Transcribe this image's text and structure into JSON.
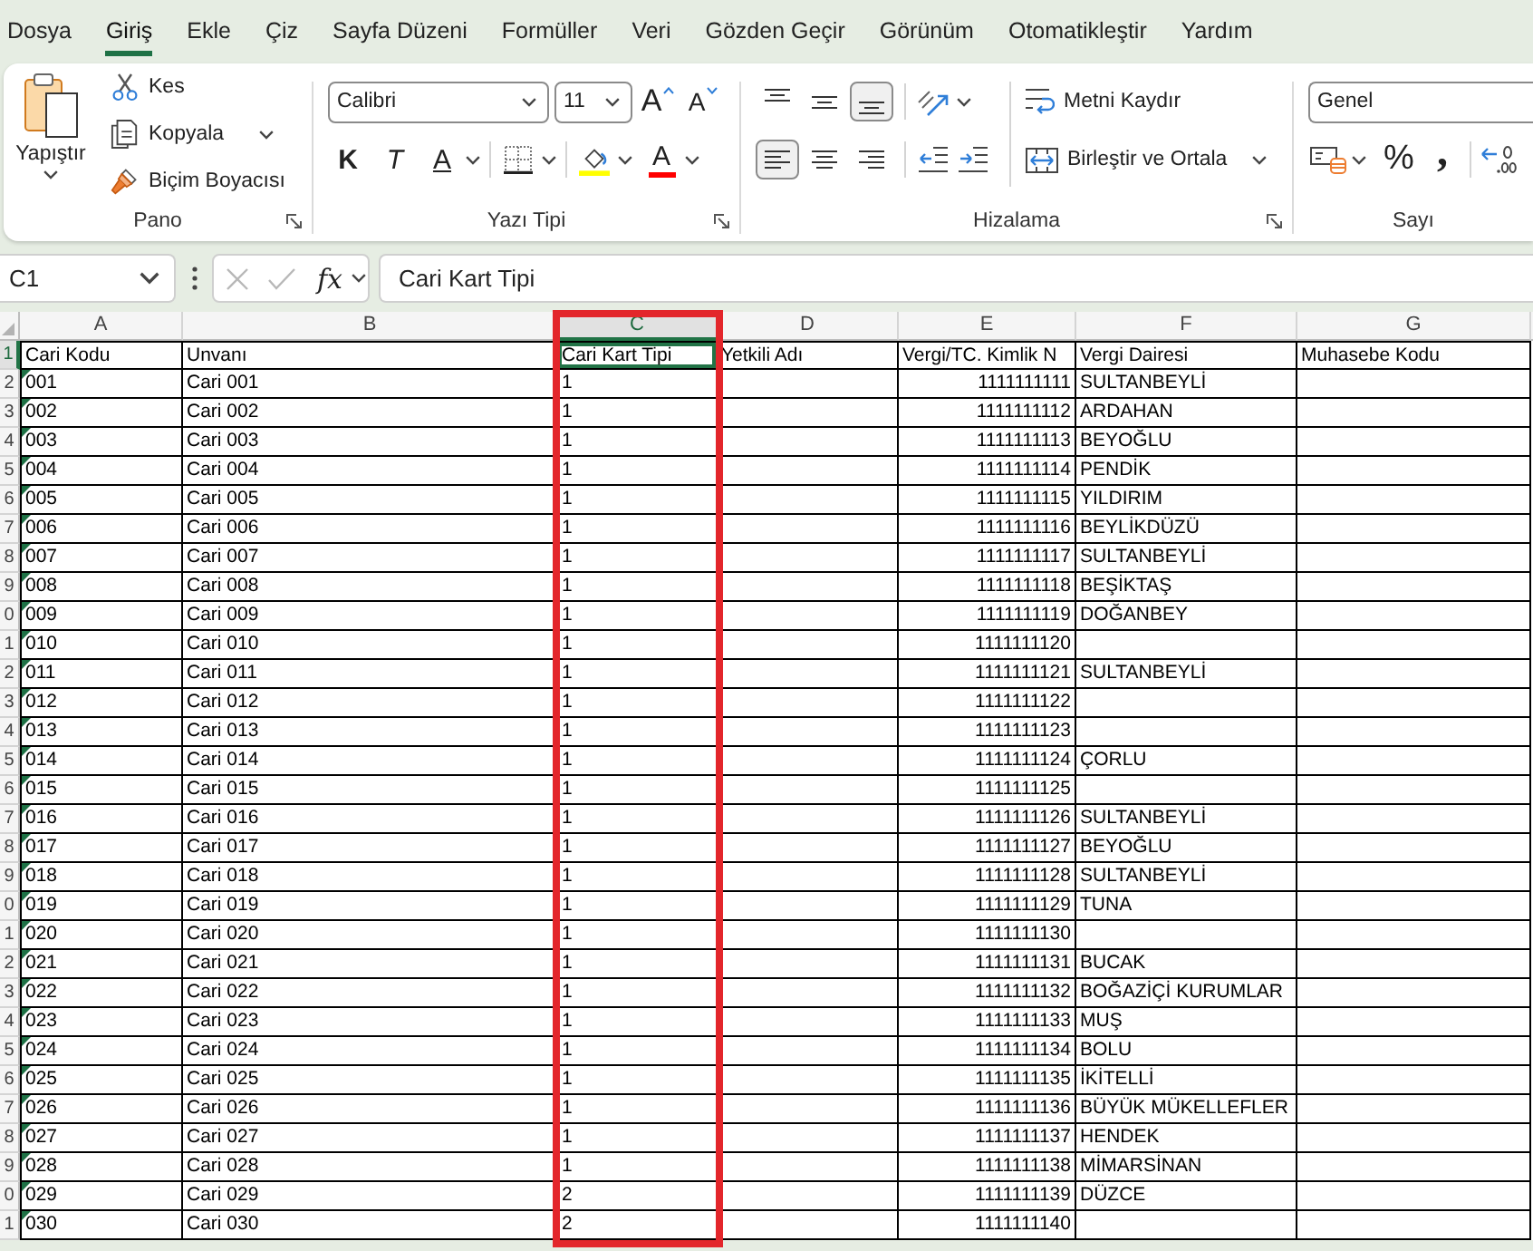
{
  "tabs": [
    {
      "label": "Dosya",
      "selected": false
    },
    {
      "label": "Giriş",
      "selected": true
    },
    {
      "label": "Ekle",
      "selected": false
    },
    {
      "label": "Çiz",
      "selected": false
    },
    {
      "label": "Sayfa Düzeni",
      "selected": false
    },
    {
      "label": "Formüller",
      "selected": false
    },
    {
      "label": "Veri",
      "selected": false
    },
    {
      "label": "Gözden Geçir",
      "selected": false
    },
    {
      "label": "Görünüm",
      "selected": false
    },
    {
      "label": "Otomatikleştir",
      "selected": false
    },
    {
      "label": "Yardım",
      "selected": false
    }
  ],
  "ribbon": {
    "clipboard": {
      "label": "Pano",
      "paste": "Yapıştır",
      "cut": "Kes",
      "copy": "Kopyala",
      "format_painter": "Biçim Boyacısı"
    },
    "font": {
      "label": "Yazı Tipi",
      "family": "Calibri",
      "size": "11",
      "grow": "A",
      "shrink": "A",
      "bold": "K",
      "italic": "T",
      "underline": "A",
      "font_color": "A"
    },
    "alignment": {
      "label": "Hizalama",
      "vertical": [
        {
          "kind": "top",
          "selected": false
        },
        {
          "kind": "middle",
          "selected": false
        },
        {
          "kind": "bottom",
          "selected": true
        }
      ],
      "horizontal": [
        {
          "kind": "left",
          "selected": true
        },
        {
          "kind": "center",
          "selected": false
        },
        {
          "kind": "right",
          "selected": false
        }
      ],
      "wrap_text": "Metni Kaydır",
      "merge_center": "Birleştir ve Ortala"
    },
    "number": {
      "label": "Sayı",
      "format": "Genel",
      "percent": "%",
      "comma": ","
    }
  },
  "name_box": {
    "value": "C1"
  },
  "formula_bar": {
    "cancel": {
      "disabled": true
    },
    "enter": {
      "disabled": true
    },
    "function": "fx",
    "value": "Cari Kart Tipi"
  },
  "sheet": {
    "columns": [
      {
        "label": "A",
        "selected": false,
        "highlighted": false
      },
      {
        "label": "B",
        "selected": false,
        "highlighted": false
      },
      {
        "label": "C",
        "selected": true,
        "highlighted": true
      },
      {
        "label": "D",
        "selected": false,
        "highlighted": false
      },
      {
        "label": "E",
        "selected": false,
        "highlighted": false
      },
      {
        "label": "F",
        "selected": false,
        "highlighted": false
      },
      {
        "label": "G",
        "selected": false,
        "highlighted": false
      }
    ],
    "header_row": {
      "number": "1",
      "selected": true,
      "cells": [
        "Cari Kodu",
        "Unvanı",
        "Cari Kart Tipi",
        "Yetkili Adı",
        "Vergi/TC. Kimlik N",
        "Vergi Dairesi",
        "Muhasebe Kodu"
      ]
    },
    "rows": [
      {
        "number": "2",
        "selected": false,
        "code": "001",
        "flagged": true,
        "name": "Cari 001",
        "card_type": "1",
        "tax_no": "1111111111",
        "tax_office": "SULTANBEYLİ"
      },
      {
        "number": "3",
        "selected": false,
        "code": "002",
        "flagged": true,
        "name": "Cari 002",
        "card_type": "1",
        "tax_no": "1111111112",
        "tax_office": "ARDAHAN"
      },
      {
        "number": "4",
        "selected": false,
        "code": "003",
        "flagged": true,
        "name": "Cari 003",
        "card_type": "1",
        "tax_no": "1111111113",
        "tax_office": "BEYOĞLU"
      },
      {
        "number": "5",
        "selected": false,
        "code": "004",
        "flagged": true,
        "name": "Cari 004",
        "card_type": "1",
        "tax_no": "1111111114",
        "tax_office": "PENDİK"
      },
      {
        "number": "6",
        "selected": false,
        "code": "005",
        "flagged": true,
        "name": "Cari 005",
        "card_type": "1",
        "tax_no": "1111111115",
        "tax_office": "YILDIRIM"
      },
      {
        "number": "7",
        "selected": false,
        "code": "006",
        "flagged": true,
        "name": "Cari 006",
        "card_type": "1",
        "tax_no": "1111111116",
        "tax_office": "BEYLİKDÜZÜ"
      },
      {
        "number": "8",
        "selected": false,
        "code": "007",
        "flagged": true,
        "name": "Cari 007",
        "card_type": "1",
        "tax_no": "1111111117",
        "tax_office": "SULTANBEYLİ"
      },
      {
        "number": "9",
        "selected": false,
        "code": "008",
        "flagged": true,
        "name": "Cari 008",
        "card_type": "1",
        "tax_no": "1111111118",
        "tax_office": "BEŞİKTAŞ"
      },
      {
        "number": "0",
        "selected": false,
        "code": "009",
        "flagged": true,
        "name": "Cari 009",
        "card_type": "1",
        "tax_no": "1111111119",
        "tax_office": "DOĞANBEY"
      },
      {
        "number": "1",
        "selected": false,
        "code": "010",
        "flagged": true,
        "name": "Cari 010",
        "card_type": "1",
        "tax_no": "1111111120"
      },
      {
        "number": "2",
        "selected": false,
        "code": "011",
        "flagged": true,
        "name": "Cari 011",
        "card_type": "1",
        "tax_no": "1111111121",
        "tax_office": "SULTANBEYLİ"
      },
      {
        "number": "3",
        "selected": false,
        "code": "012",
        "flagged": true,
        "name": "Cari 012",
        "card_type": "1",
        "tax_no": "1111111122"
      },
      {
        "number": "4",
        "selected": false,
        "code": "013",
        "flagged": true,
        "name": "Cari 013",
        "card_type": "1",
        "tax_no": "1111111123"
      },
      {
        "number": "5",
        "selected": false,
        "code": "014",
        "flagged": true,
        "name": "Cari 014",
        "card_type": "1",
        "tax_no": "1111111124",
        "tax_office": "ÇORLU"
      },
      {
        "number": "6",
        "selected": false,
        "code": "015",
        "flagged": true,
        "name": "Cari 015",
        "card_type": "1",
        "tax_no": "1111111125"
      },
      {
        "number": "7",
        "selected": false,
        "code": "016",
        "flagged": true,
        "name": "Cari 016",
        "card_type": "1",
        "tax_no": "1111111126",
        "tax_office": "SULTANBEYLİ"
      },
      {
        "number": "8",
        "selected": false,
        "code": "017",
        "flagged": true,
        "name": "Cari 017",
        "card_type": "1",
        "tax_no": "1111111127",
        "tax_office": "BEYOĞLU"
      },
      {
        "number": "9",
        "selected": false,
        "code": "018",
        "flagged": true,
        "name": "Cari 018",
        "card_type": "1",
        "tax_no": "1111111128",
        "tax_office": "SULTANBEYLİ"
      },
      {
        "number": "0",
        "selected": false,
        "code": "019",
        "flagged": true,
        "name": "Cari 019",
        "card_type": "1",
        "tax_no": "1111111129",
        "tax_office": "TUNA"
      },
      {
        "number": "1",
        "selected": false,
        "code": "020",
        "flagged": true,
        "name": "Cari 020",
        "card_type": "1",
        "tax_no": "1111111130"
      },
      {
        "number": "2",
        "selected": false,
        "code": "021",
        "flagged": true,
        "name": "Cari 021",
        "card_type": "1",
        "tax_no": "1111111131",
        "tax_office": "BUCAK"
      },
      {
        "number": "3",
        "selected": false,
        "code": "022",
        "flagged": true,
        "name": "Cari 022",
        "card_type": "1",
        "tax_no": "1111111132",
        "tax_office": "BOĞAZİÇİ KURUMLAR"
      },
      {
        "number": "4",
        "selected": false,
        "code": "023",
        "flagged": true,
        "name": "Cari 023",
        "card_type": "1",
        "tax_no": "1111111133",
        "tax_office": "MUŞ"
      },
      {
        "number": "5",
        "selected": false,
        "code": "024",
        "flagged": true,
        "name": "Cari 024",
        "card_type": "1",
        "tax_no": "1111111134",
        "tax_office": "BOLU"
      },
      {
        "number": "6",
        "selected": false,
        "code": "025",
        "flagged": true,
        "name": "Cari 025",
        "card_type": "1",
        "tax_no": "1111111135",
        "tax_office": "İKİTELLİ"
      },
      {
        "number": "7",
        "selected": false,
        "code": "026",
        "flagged": true,
        "name": "Cari 026",
        "card_type": "1",
        "tax_no": "1111111136",
        "tax_office": "BÜYÜK MÜKELLEFLER"
      },
      {
        "number": "8",
        "selected": false,
        "code": "027",
        "flagged": true,
        "name": "Cari 027",
        "card_type": "1",
        "tax_no": "1111111137",
        "tax_office": "HENDEK"
      },
      {
        "number": "9",
        "selected": false,
        "code": "028",
        "flagged": true,
        "name": "Cari 028",
        "card_type": "1",
        "tax_no": "1111111138",
        "tax_office": "MİMARSİNAN"
      },
      {
        "number": "0",
        "selected": false,
        "code": "029",
        "flagged": true,
        "name": "Cari 029",
        "card_type": "2",
        "tax_no": "1111111139",
        "tax_office": "DÜZCE"
      },
      {
        "number": "1",
        "selected": false,
        "code": "030",
        "flagged": true,
        "name": "Cari 030",
        "card_type": "2",
        "tax_no": "1111111140"
      }
    ]
  }
}
